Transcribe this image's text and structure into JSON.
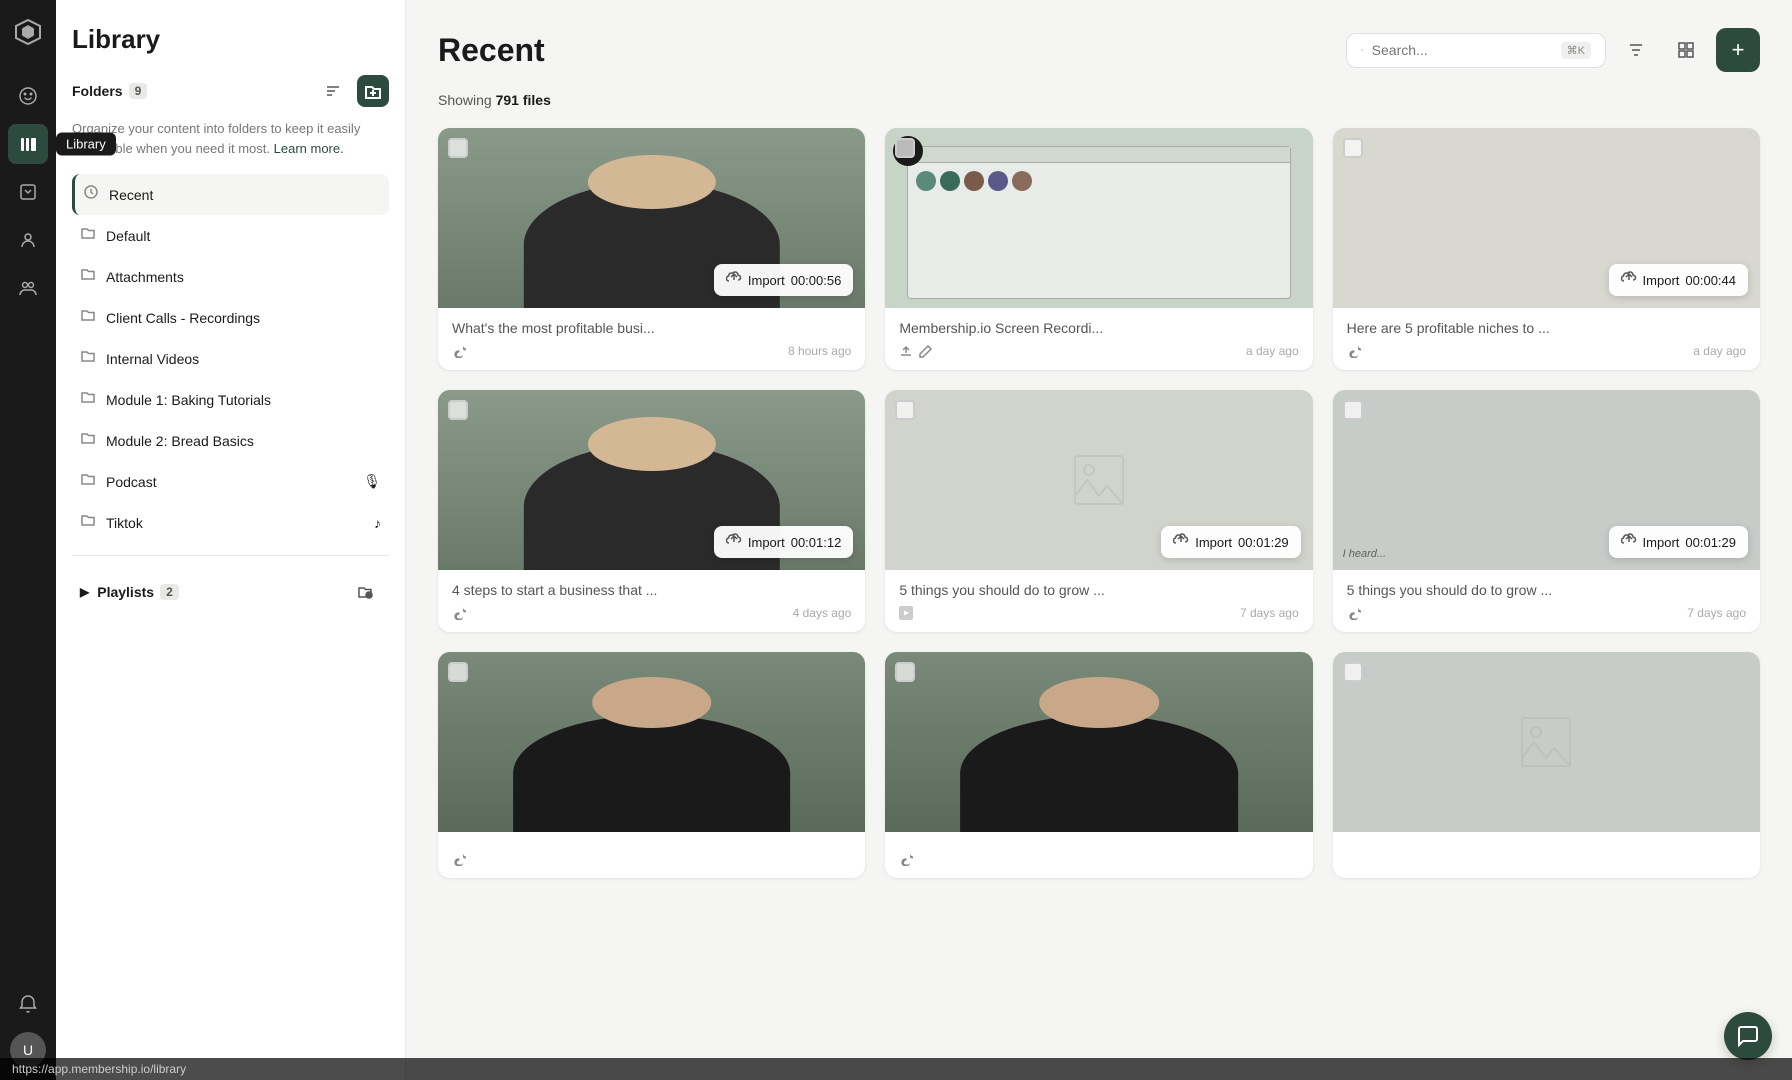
{
  "app": {
    "title": "Library",
    "page_title": "Recent"
  },
  "sidebar": {
    "title": "Library",
    "folders_label": "Folders",
    "folders_count": "9",
    "folder_desc": "Organize your content into folders to keep it easily accessible when you need it most.",
    "learn_more": "Learn more.",
    "items": [
      {
        "id": "recent",
        "name": "Recent",
        "icon": "clock",
        "active": true
      },
      {
        "id": "default",
        "name": "Default",
        "icon": "folder"
      },
      {
        "id": "attachments",
        "name": "Attachments",
        "icon": "folder"
      },
      {
        "id": "client-calls",
        "name": "Client Calls - Recordings",
        "icon": "folder"
      },
      {
        "id": "internal-videos",
        "name": "Internal Videos",
        "icon": "folder"
      },
      {
        "id": "module-1",
        "name": "Module 1: Baking Tutorials",
        "icon": "folder"
      },
      {
        "id": "module-2",
        "name": "Module 2: Bread Basics",
        "icon": "folder"
      },
      {
        "id": "podcast",
        "name": "Podcast",
        "icon": "folder",
        "special_icon": "mic"
      },
      {
        "id": "tiktok",
        "name": "Tiktok",
        "icon": "folder",
        "special_icon": "tiktok"
      }
    ],
    "playlists_label": "Playlists",
    "playlists_count": "2"
  },
  "main": {
    "title": "Recent",
    "showing_text": "Showing",
    "file_count": "791 files",
    "search_placeholder": "Search...",
    "search_shortcut": "⌘K",
    "add_button_label": "+"
  },
  "cards": [
    {
      "id": 1,
      "title": "What's the most profitable busi...",
      "source": "tiktok",
      "time": "8 hours ago",
      "has_import": true,
      "import_time": "00:00:56",
      "thumb_type": "person"
    },
    {
      "id": 2,
      "title": "Membership.io Screen Recordi...",
      "source": "upload",
      "time": "a day ago",
      "has_import": false,
      "thumb_type": "screen"
    },
    {
      "id": 3,
      "title": "Here are 5 profitable niches to ...",
      "source": "tiktok",
      "time": "a day ago",
      "has_import": true,
      "import_time": "00:00:44",
      "thumb_type": "empty"
    },
    {
      "id": 4,
      "title": "4 steps to start a business that ...",
      "source": "tiktok",
      "time": "4 days ago",
      "has_import": true,
      "import_time": "00:01:12",
      "thumb_type": "person"
    },
    {
      "id": 5,
      "title": "5 things you should do to grow ...",
      "source": "youtube",
      "time": "7 days ago",
      "has_import": true,
      "import_time": "00:01:29",
      "thumb_type": "empty"
    },
    {
      "id": 6,
      "title": "5 things you should do to grow ...",
      "source": "tiktok",
      "time": "7 days ago",
      "has_import": true,
      "import_time": "00:01:29",
      "thumb_type": "text_overlay"
    },
    {
      "id": 7,
      "title": "",
      "source": "tiktok",
      "time": "",
      "has_import": false,
      "thumb_type": "person2"
    },
    {
      "id": 8,
      "title": "",
      "source": "tiktok",
      "time": "",
      "has_import": false,
      "thumb_type": "person2"
    },
    {
      "id": 9,
      "title": "",
      "source": "",
      "time": "",
      "has_import": false,
      "thumb_type": "empty"
    }
  ],
  "tooltip": {
    "library": "Library"
  },
  "status_bar": {
    "url": "https://app.membership.io/library"
  },
  "nav_icons": [
    {
      "id": "logo",
      "icon": "mountain"
    },
    {
      "id": "menu",
      "icon": "menu"
    },
    {
      "id": "library",
      "icon": "library",
      "active": true
    },
    {
      "id": "courses",
      "icon": "courses"
    },
    {
      "id": "members",
      "icon": "members"
    },
    {
      "id": "groups",
      "icon": "groups"
    }
  ]
}
